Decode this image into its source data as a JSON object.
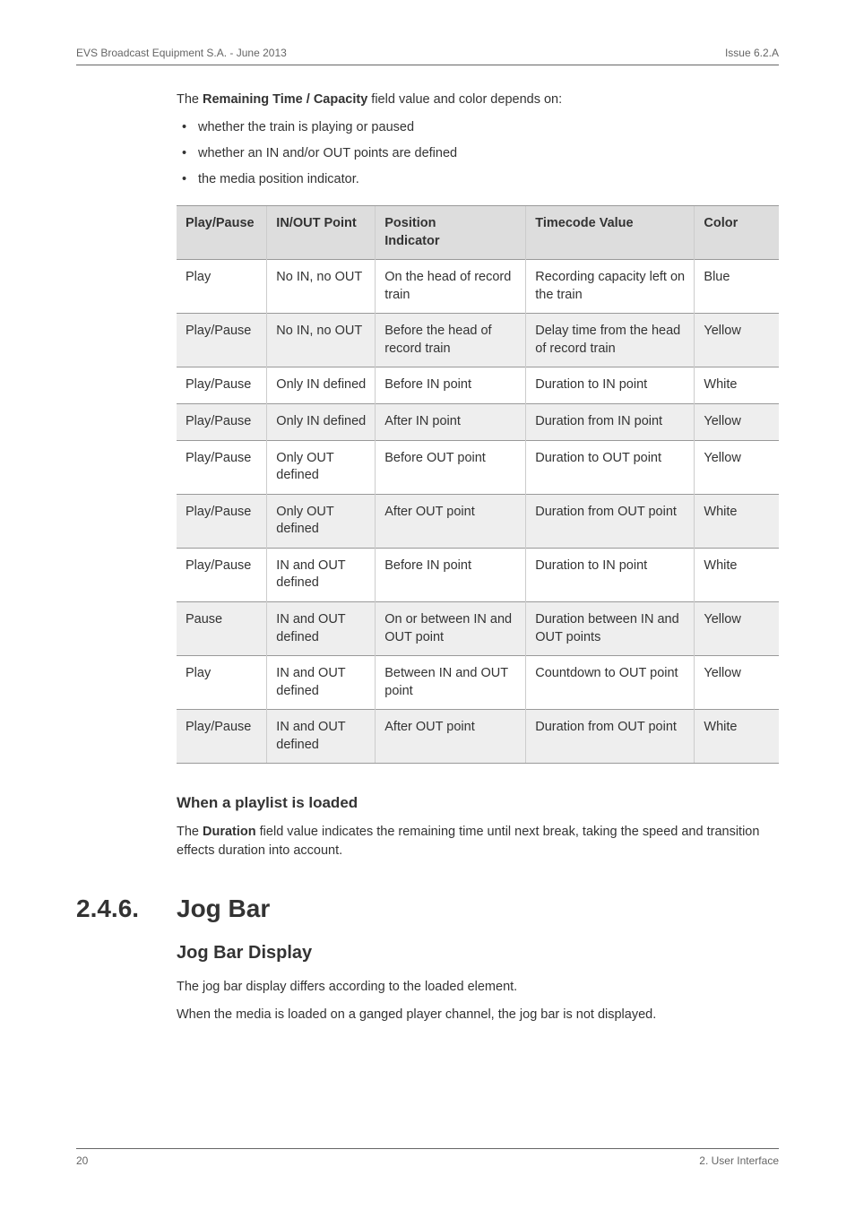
{
  "header": {
    "left": "EVS Broadcast Equipment S.A.  - June 2013",
    "right": "Issue 6.2.A"
  },
  "intro": {
    "line": "The ",
    "bold": "Remaining Time / Capacity",
    "after": " field value and color depends on:",
    "bullets": [
      "whether the train is playing or paused",
      "whether an IN and/or OUT points are defined",
      "the media position indicator."
    ]
  },
  "table": {
    "headers": {
      "c0": "Play/Pause",
      "c1": "IN/OUT Point",
      "c2_l1": "Position",
      "c2_l2": "Indicator",
      "c3": "Timecode Value",
      "c4": "Color"
    },
    "rows": [
      {
        "c0": "Play",
        "c1": "No IN, no OUT",
        "c2": "On the head of record train",
        "c3": "Recording capacity left on the train",
        "c4": "Blue"
      },
      {
        "c0": "Play/Pause",
        "c1": "No IN, no OUT",
        "c2": "Before the head of record train",
        "c3": "Delay time from the head of record train",
        "c4": "Yellow"
      },
      {
        "c0": "Play/Pause",
        "c1": "Only IN defined",
        "c2": "Before IN point",
        "c3": "Duration to IN point",
        "c4": "White"
      },
      {
        "c0": "Play/Pause",
        "c1": "Only IN defined",
        "c2": "After IN point",
        "c3": "Duration from IN point",
        "c4": "Yellow"
      },
      {
        "c0": "Play/Pause",
        "c1": "Only OUT defined",
        "c2": "Before OUT point",
        "c3": "Duration to OUT point",
        "c4": "Yellow"
      },
      {
        "c0": "Play/Pause",
        "c1": "Only OUT defined",
        "c2": "After OUT point",
        "c3": "Duration from OUT point",
        "c4": "White"
      },
      {
        "c0": "Play/Pause",
        "c1": "IN and OUT defined",
        "c2": "Before IN point",
        "c3": "Duration to IN point",
        "c4": "White"
      },
      {
        "c0": "Pause",
        "c1": "IN and OUT defined",
        "c2": "On or between IN and OUT point",
        "c3": "Duration between IN and OUT points",
        "c4": "Yellow"
      },
      {
        "c0": "Play",
        "c1": "IN and OUT defined",
        "c2": "Between IN and OUT point",
        "c3": "Countdown to OUT point",
        "c4": "Yellow"
      },
      {
        "c0": "Play/Pause",
        "c1": "IN and OUT defined",
        "c2": "After OUT point",
        "c3": "Duration from OUT point",
        "c4": "White"
      }
    ]
  },
  "playlist": {
    "heading": "When a playlist is loaded",
    "pre": "The ",
    "bold": "Duration",
    "after": " field value indicates the remaining time until next break, taking the speed and transition effects duration into account."
  },
  "section": {
    "num": "2.4.6.",
    "title": "Jog Bar",
    "sub": "Jog Bar Display",
    "p1": "The jog bar display differs according to the loaded element.",
    "p2": "When the media is loaded on a ganged player channel, the jog bar is not displayed."
  },
  "footer": {
    "left": "20",
    "right": "2. User Interface"
  }
}
